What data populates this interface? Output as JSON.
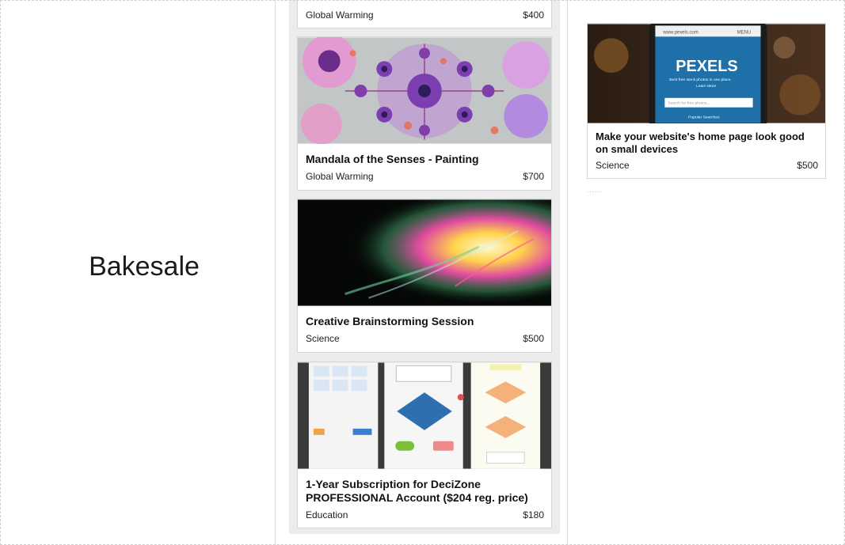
{
  "app": {
    "name": "Bakesale"
  },
  "list": {
    "items": [
      {
        "title": "",
        "cause": "Global Warming",
        "price": "$400"
      },
      {
        "title": "Mandala of the Senses - Painting",
        "cause": "Global Warming",
        "price": "$700"
      },
      {
        "title": "Creative Brainstorming Session",
        "cause": "Science",
        "price": "$500"
      },
      {
        "title": "1-Year Subscription for DeciZone PROFESSIONAL Account ($204 reg. price)",
        "cause": "Education",
        "price": "$180"
      }
    ]
  },
  "detail": {
    "title": "Make your website's home page look good on small devices",
    "cause": "Science",
    "price": "$500",
    "image_text": {
      "url": "www.pexels.com",
      "menu": "MENU",
      "brand": "PEXELS",
      "tagline": "Best free stock photos in one place.",
      "learn_more": "Learn More",
      "search_placeholder": "Search for free photos...",
      "popular": "Popular Searches"
    },
    "loading": "......"
  },
  "colors": {
    "accent_blue": "#2f7fbf",
    "flow_diamond": "#2e6fb0",
    "flow_green": "#7bbf3a",
    "flow_orange": "#f4b27a"
  }
}
